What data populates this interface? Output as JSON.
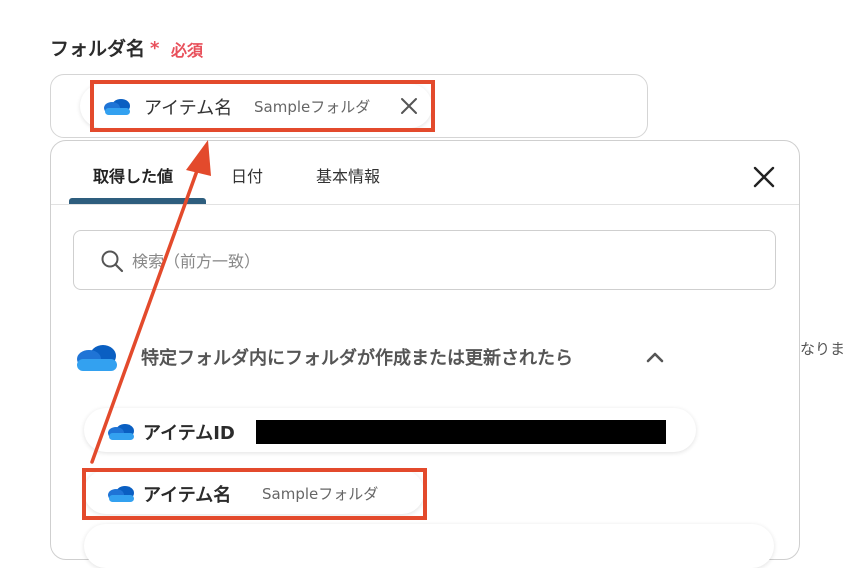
{
  "field": {
    "label": "フォルダ名",
    "required_star": "*",
    "required_text": "必須"
  },
  "selected_chip": {
    "icon": "onedrive-cloud-icon",
    "name": "アイテム名",
    "value": "Sampleフォルダ"
  },
  "panel": {
    "tabs": [
      {
        "label": "取得した値",
        "active": true
      },
      {
        "label": "日付",
        "active": false
      },
      {
        "label": "基本情報",
        "active": false
      }
    ],
    "close_icon": "close-icon",
    "search": {
      "placeholder": "検索（前方一致）",
      "value": "",
      "icon": "search-icon"
    },
    "section": {
      "icon": "onedrive-cloud-icon",
      "title": "特定フォルダ内にフォルダが作成または更新されたら",
      "toggle_icon": "chevron-up-icon"
    },
    "items": [
      {
        "name": "アイテムID",
        "value_redacted": true
      },
      {
        "name": "アイテム名",
        "value": "Sampleフォルダ"
      }
    ]
  },
  "side_text": "なりま",
  "colors": {
    "required": "#e8505b",
    "tab_active_underline": "#2e5e7e",
    "highlight": "#e34a2c",
    "onedrive_blue": "#1f74d6"
  }
}
